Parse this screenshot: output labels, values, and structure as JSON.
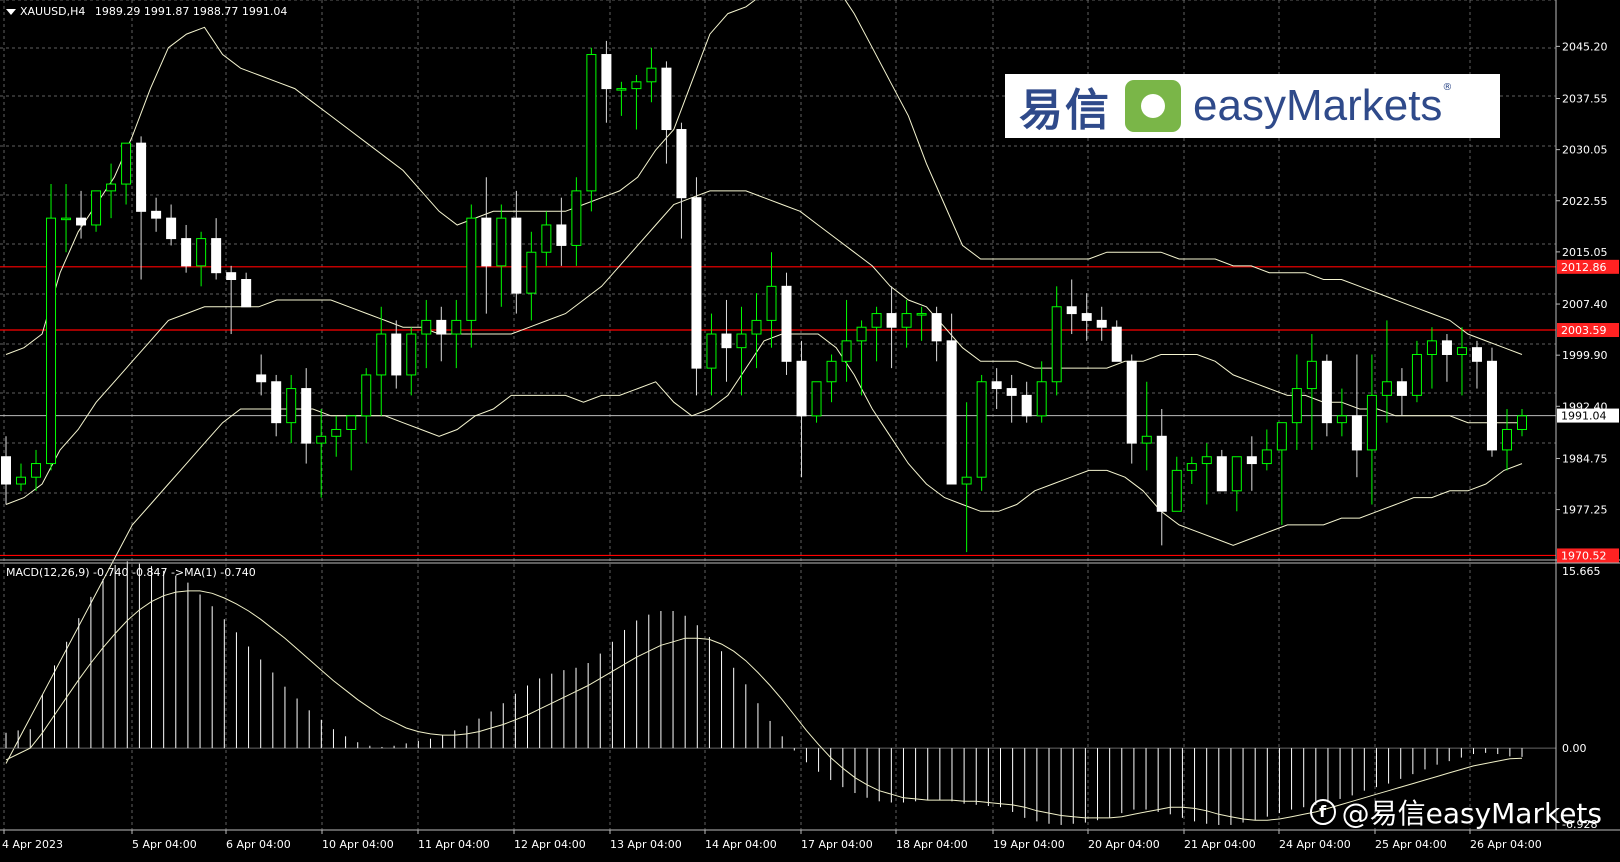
{
  "symbol_header": {
    "symbol": "XAUUSD,H4",
    "open": "1989.29",
    "high": "1991.87",
    "low": "1988.77",
    "close": "1991.04"
  },
  "macd_header": {
    "label": "MACD(12,26,9) -0.740 -0.847 ->MA(1) -0.740"
  },
  "logo": {
    "chinese": "易信",
    "english": "easyMarkets",
    "reg": "®"
  },
  "watermark": {
    "text": "@易信easyMarkets",
    "icon": "facebook-icon"
  },
  "colors": {
    "background": "#000000",
    "grid": "#888888",
    "bull": "#00ff00",
    "bear": "#ffffff",
    "band": "#f5f5d0",
    "level_line": "#ff0000",
    "level_badge": "#ff2222"
  },
  "chart_data": [
    {
      "type": "candlestick",
      "title": "XAUUSD,H4",
      "ylim": [
        1970,
        2052
      ],
      "y_ticks": [
        "2045.20",
        "2037.55",
        "2030.05",
        "2022.55",
        "2015.05",
        "2007.40",
        "1999.90",
        "1992.40",
        "1984.75",
        "1977.25"
      ],
      "x_ticks": [
        "4 Apr 2023",
        "5 Apr 04:00",
        "6 Apr 04:00",
        "10 Apr 04:00",
        "11 Apr 04:00",
        "12 Apr 04:00",
        "13 Apr 04:00",
        "14 Apr 04:00",
        "17 Apr 04:00",
        "18 Apr 04:00",
        "19 Apr 04:00",
        "20 Apr 04:00",
        "21 Apr 04:00",
        "24 Apr 04:00",
        "25 Apr 04:00",
        "26 Apr 04:00"
      ],
      "current_price": "1991.04",
      "levels": [
        "2012.86",
        "2003.59",
        "1970.52"
      ],
      "candles": [
        [
          1985,
          1988,
          1978,
          1981
        ],
        [
          1981,
          1984,
          1980,
          1982
        ],
        [
          1982,
          1986,
          1980,
          1984
        ],
        [
          1984,
          2025,
          1983,
          2020
        ],
        [
          2020,
          2025,
          2015,
          2020
        ],
        [
          2020,
          2024,
          2017,
          2019
        ],
        [
          2019,
          2024,
          2018,
          2024
        ],
        [
          2024,
          2028,
          2020,
          2025
        ],
        [
          2025,
          2030,
          2022,
          2031
        ],
        [
          2031,
          2032,
          2011,
          2021
        ],
        [
          2021,
          2023,
          2018,
          2020
        ],
        [
          2020,
          2022,
          2016,
          2017
        ],
        [
          2017,
          2019,
          2012,
          2013
        ],
        [
          2013,
          2018,
          2010,
          2017
        ],
        [
          2017,
          2020,
          2011,
          2012
        ],
        [
          2012,
          2013,
          2003,
          2011
        ],
        [
          2011,
          2012,
          2007,
          2007
        ],
        [
          1997,
          2000,
          1994,
          1996
        ],
        [
          1996,
          1997,
          1988,
          1990
        ],
        [
          1990,
          1997,
          1987,
          1995
        ],
        [
          1995,
          1998,
          1984,
          1987
        ],
        [
          1987,
          1992,
          1979,
          1988
        ],
        [
          1988,
          1991,
          1985,
          1989
        ],
        [
          1989,
          1991,
          1983,
          1991
        ],
        [
          1991,
          1998,
          1987,
          1997
        ],
        [
          1997,
          2007,
          1991,
          2003
        ],
        [
          2003,
          2005,
          1995,
          1997
        ],
        [
          1997,
          2004,
          1994,
          2003
        ],
        [
          2003,
          2008,
          1998,
          2005
        ],
        [
          2005,
          2007,
          1999,
          2003
        ],
        [
          2003,
          2008,
          1998,
          2005
        ],
        [
          2005,
          2022,
          2001,
          2020
        ],
        [
          2020,
          2026,
          2006,
          2013
        ],
        [
          2013,
          2022,
          2007,
          2020
        ],
        [
          2020,
          2024,
          2006,
          2009
        ],
        [
          2009,
          2018,
          2005,
          2015
        ],
        [
          2015,
          2021,
          2013,
          2019
        ],
        [
          2019,
          2023,
          2013,
          2016
        ],
        [
          2016,
          2026,
          2013,
          2024
        ],
        [
          2024,
          2045,
          2021,
          2044
        ],
        [
          2044,
          2046,
          2034,
          2039
        ],
        [
          2039,
          2040,
          2035,
          2039
        ],
        [
          2039,
          2041,
          2033,
          2040
        ],
        [
          2040,
          2045,
          2037,
          2042
        ],
        [
          2042,
          2043,
          2028,
          2033
        ],
        [
          2033,
          2034,
          2017,
          2023
        ],
        [
          2023,
          2026,
          1994,
          1998
        ],
        [
          1998,
          2006,
          1994,
          2003
        ],
        [
          2003,
          2008,
          1996,
          2001
        ],
        [
          2001,
          2007,
          1994,
          2003
        ],
        [
          2003,
          2009,
          1998,
          2005
        ],
        [
          2005,
          2015,
          2001,
          2010
        ],
        [
          2010,
          2012,
          1997,
          1999
        ],
        [
          1999,
          2002,
          1982,
          1991
        ],
        [
          1991,
          1996,
          1990,
          1996
        ],
        [
          1996,
          2000,
          1993,
          1999
        ],
        [
          1999,
          2008,
          1996,
          2002
        ],
        [
          2002,
          2005,
          1994,
          2004
        ],
        [
          2004,
          2007,
          1999,
          2006
        ],
        [
          2006,
          2010,
          1998,
          2004
        ],
        [
          2004,
          2008,
          2001,
          2006
        ],
        [
          2006,
          2007,
          2002,
          2006
        ],
        [
          2006,
          2007,
          1999,
          2002
        ],
        [
          2002,
          2006,
          1982,
          1981
        ],
        [
          1981,
          1993,
          1971,
          1982
        ],
        [
          1982,
          1997,
          1980,
          1996
        ],
        [
          1996,
          1998,
          1992,
          1995
        ],
        [
          1995,
          1997,
          1990,
          1994
        ],
        [
          1994,
          1996,
          1990,
          1991
        ],
        [
          1991,
          1999,
          1990,
          1996
        ],
        [
          1996,
          2010,
          1994,
          2007
        ],
        [
          2007,
          2011,
          2003,
          2006
        ],
        [
          2006,
          2009,
          2002,
          2005
        ],
        [
          2005,
          2007,
          2002,
          2004
        ],
        [
          2004,
          2005,
          1999,
          1999
        ],
        [
          1999,
          2000,
          1984,
          1987
        ],
        [
          1987,
          1996,
          1983,
          1988
        ],
        [
          1988,
          1992,
          1972,
          1977
        ],
        [
          1977,
          1985,
          1978,
          1983
        ],
        [
          1983,
          1985,
          1981,
          1984
        ],
        [
          1984,
          1987,
          1978,
          1985
        ],
        [
          1985,
          1986,
          1980,
          1980
        ],
        [
          1980,
          1985,
          1977,
          1985
        ],
        [
          1985,
          1988,
          1980,
          1984
        ],
        [
          1984,
          1989,
          1983,
          1986
        ],
        [
          1986,
          1990,
          1975,
          1990
        ],
        [
          1990,
          2000,
          1986,
          1995
        ],
        [
          1995,
          2003,
          1986,
          1999
        ],
        [
          1999,
          2000,
          1988,
          1990
        ],
        [
          1990,
          1995,
          1988,
          1991
        ],
        [
          1991,
          2000,
          1982,
          1986
        ],
        [
          1986,
          2000,
          1978,
          1994
        ],
        [
          1994,
          2005,
          1990,
          1996
        ],
        [
          1996,
          1998,
          1991,
          1994
        ],
        [
          1994,
          2002,
          1993,
          2000
        ],
        [
          2000,
          2004,
          1995,
          2002
        ],
        [
          2002,
          2003,
          1996,
          2000
        ],
        [
          2000,
          2004,
          1994,
          2001
        ],
        [
          2001,
          2002,
          1995,
          1999
        ],
        [
          1999,
          2001,
          1985,
          1986
        ],
        [
          1986,
          1992,
          1983,
          1989
        ],
        [
          1989,
          1992,
          1988,
          1991
        ]
      ],
      "bollinger": {
        "upper": [
          2000,
          2001,
          2003,
          2012,
          2018,
          2022,
          2026,
          2032,
          2039,
          2045,
          2047,
          2048,
          2044,
          2042,
          2041,
          2040,
          2039,
          2037,
          2035,
          2033,
          2031,
          2029,
          2027,
          2024,
          2021,
          2019,
          2020,
          2021,
          2021,
          2021,
          2021,
          2021,
          2022,
          2023,
          2024,
          2026,
          2030,
          2033,
          2040,
          2047,
          2050,
          2051,
          2053,
          2055,
          2055,
          2055,
          2054,
          2050,
          2045,
          2040,
          2035,
          2028,
          2022,
          2016,
          2014,
          2014,
          2014,
          2014,
          2014,
          2014,
          2014,
          2015,
          2015,
          2015,
          2015,
          2014,
          2014,
          2014,
          2013,
          2013,
          2012,
          2012,
          2012,
          2011,
          2011,
          2010,
          2009,
          2008,
          2007,
          2006,
          2005,
          2003,
          2002,
          2001,
          2000
        ],
        "mid": [
          1978,
          1979,
          1981,
          1986,
          1989,
          1993,
          1996,
          1999,
          2002,
          2005,
          2006,
          2007,
          2007,
          2007,
          2007,
          2008,
          2008,
          2008,
          2008,
          2007,
          2006,
          2005,
          2004,
          2004,
          2003,
          2003,
          2003,
          2003,
          2003,
          2004,
          2005,
          2006,
          2008,
          2010,
          2013,
          2016,
          2019,
          2022,
          2023,
          2024,
          2024,
          2024,
          2023,
          2022,
          2021,
          2019,
          2017,
          2015,
          2013,
          2010,
          2008,
          2007,
          2004,
          2001,
          1999,
          1999,
          1999,
          1998,
          1998,
          1998,
          1998,
          1998,
          1999,
          1999,
          2000,
          2000,
          2000,
          1999,
          1997,
          1996,
          1995,
          1994,
          1994,
          1993,
          1993,
          1992,
          1992,
          1991,
          1991,
          1991,
          1991,
          1990,
          1990,
          1990,
          1990
        ],
        "lower": [
          1940,
          1945,
          1950,
          1955,
          1960,
          1965,
          1970,
          1975,
          1978,
          1981,
          1984,
          1987,
          1990,
          1992,
          1992,
          1992,
          1992,
          1992,
          1991,
          1991,
          1991,
          1991,
          1990,
          1989,
          1988,
          1989,
          1991,
          1992,
          1994,
          1994,
          1994,
          1994,
          1993,
          1994,
          1994,
          1995,
          1996,
          1993,
          1991,
          1992,
          1994,
          1998,
          2002,
          2003,
          2003,
          2003,
          2001,
          1997,
          1992,
          1988,
          1984,
          1981,
          1979,
          1978,
          1977,
          1977,
          1978,
          1980,
          1981,
          1982,
          1983,
          1983,
          1982,
          1980,
          1977,
          1975,
          1974,
          1973,
          1972,
          1973,
          1974,
          1975,
          1975,
          1975,
          1976,
          1976,
          1977,
          1978,
          1979,
          1979,
          1980,
          1980,
          1981,
          1983,
          1984
        ]
      }
    },
    {
      "type": "bar",
      "title": "MACD(12,26,9) -0.740 -0.847 ->MA(1) -0.740",
      "ylim": [
        -6.928,
        15.665
      ],
      "y_ticks": [
        "15.665",
        "0.00",
        "-6.928"
      ],
      "macd_values": [
        1.3,
        1.5,
        1.6,
        4.5,
        7.0,
        9.0,
        11.0,
        12.8,
        14.3,
        15.5,
        15.8,
        15.6,
        15.4,
        15.0,
        14.6,
        14.0,
        13.0,
        12.0,
        10.9,
        9.8,
        8.6,
        7.5,
        6.4,
        5.2,
        4.2,
        3.2,
        2.4,
        1.6,
        1.0,
        0.5,
        0.2,
        0.1,
        0.2,
        0.4,
        0.6,
        0.8,
        1.1,
        1.5,
        1.9,
        2.5,
        3.1,
        3.8,
        4.6,
        5.3,
        5.9,
        6.3,
        6.6,
        6.8,
        7.2,
        8.0,
        9.0,
        10.0,
        10.8,
        11.3,
        11.6,
        11.6,
        11.2,
        10.4,
        9.4,
        8.2,
        6.8,
        5.4,
        3.8,
        2.3,
        1.0,
        -0.2,
        -1.2,
        -2.0,
        -2.7,
        -3.3,
        -3.8,
        -4.2,
        -4.5,
        -4.6,
        -4.6,
        -4.5,
        -4.4,
        -4.4,
        -4.5,
        -4.7,
        -4.8,
        -4.9,
        -5.0,
        -5.4,
        -5.9,
        -6.2,
        -6.4,
        -6.5,
        -6.4,
        -6.3,
        -6.1,
        -5.9,
        -5.5,
        -5.2,
        -5.2,
        -5.4,
        -5.6,
        -5.9,
        -6.2,
        -6.4,
        -6.5,
        -6.5,
        -6.3,
        -6.1,
        -5.8,
        -5.5,
        -5.2,
        -5.0,
        -4.8,
        -4.6,
        -4.3,
        -4.0,
        -3.6,
        -3.3,
        -3.0,
        -2.6,
        -2.2,
        -1.8,
        -1.4,
        -1.1,
        -0.8,
        -0.5,
        -0.4,
        -0.5,
        -0.7,
        -0.74
      ],
      "signal_values": [
        -1.0,
        -0.5,
        0.0,
        1.3,
        2.8,
        4.3,
        5.8,
        7.2,
        8.5,
        9.7,
        10.8,
        11.7,
        12.4,
        12.9,
        13.2,
        13.3,
        13.3,
        13.1,
        12.7,
        12.2,
        11.6,
        10.9,
        10.1,
        9.3,
        8.4,
        7.5,
        6.6,
        5.7,
        4.9,
        4.1,
        3.4,
        2.7,
        2.2,
        1.7,
        1.4,
        1.2,
        1.1,
        1.1,
        1.2,
        1.4,
        1.7,
        2.0,
        2.4,
        2.8,
        3.3,
        3.8,
        4.3,
        4.8,
        5.3,
        5.9,
        6.5,
        7.1,
        7.7,
        8.2,
        8.7,
        9.0,
        9.3,
        9.3,
        9.2,
        8.8,
        8.2,
        7.4,
        6.4,
        5.3,
        4.1,
        2.8,
        1.5,
        0.3,
        -0.8,
        -1.7,
        -2.5,
        -3.1,
        -3.6,
        -3.9,
        -4.2,
        -4.3,
        -4.4,
        -4.4,
        -4.4,
        -4.5,
        -4.5,
        -4.6,
        -4.7,
        -4.8,
        -5.0,
        -5.3,
        -5.5,
        -5.7,
        -5.8,
        -5.9,
        -5.9,
        -5.9,
        -5.8,
        -5.6,
        -5.4,
        -5.2,
        -5.0,
        -5.0,
        -5.1,
        -5.3,
        -5.6,
        -5.8,
        -6.0,
        -6.1,
        -6.1,
        -6.0,
        -5.8,
        -5.6,
        -5.4,
        -5.1,
        -4.8,
        -4.5,
        -4.2,
        -3.9,
        -3.6,
        -3.3,
        -3.0,
        -2.7,
        -2.4,
        -2.1,
        -1.8,
        -1.5,
        -1.3,
        -1.1,
        -0.9,
        -0.85
      ]
    }
  ]
}
